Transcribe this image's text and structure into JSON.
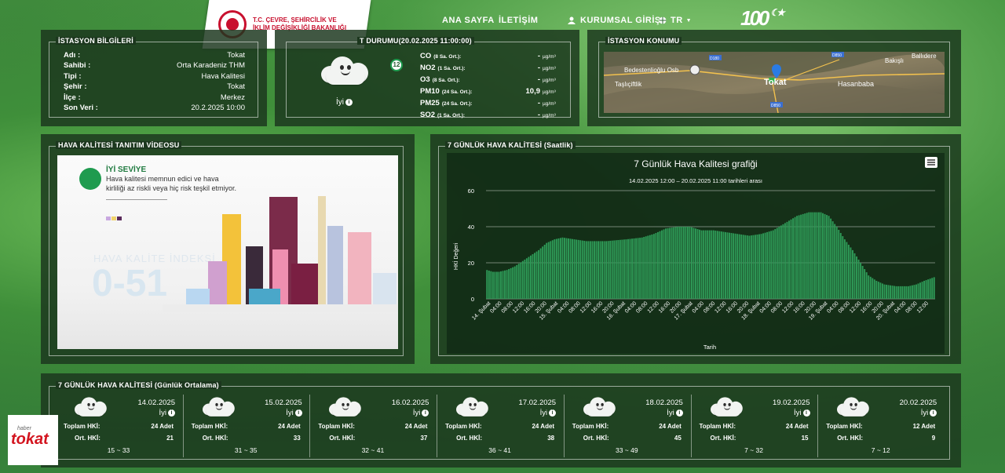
{
  "nav": {
    "home": "ANA SAYFA",
    "contact": "İLETİŞİM",
    "login": "KURUMSAL GİRİŞ",
    "lang": "TR",
    "anniversary": "100"
  },
  "logo": {
    "line1": "T.C. ÇEVRE, ŞEHİRCİLİK VE",
    "line2": "İKLİM DEĞİŞİKLİĞİ BAKANLIĞI"
  },
  "station": {
    "title": "İSTASYON BİLGİLERİ",
    "rows": [
      {
        "k": "Adı :",
        "v": "Tokat"
      },
      {
        "k": "Sahibi :",
        "v": "Orta Karadeniz THM"
      },
      {
        "k": "Tipi :",
        "v": "Hava Kalitesi"
      },
      {
        "k": "Şehir :",
        "v": "Tokat"
      },
      {
        "k": "İlçe :",
        "v": "Merkez"
      },
      {
        "k": "Son Veri :",
        "v": "20.2.2025 10:00"
      }
    ]
  },
  "current": {
    "title": "T DURUMU(20.02.2025 11:00:00)",
    "index": "12",
    "status": "İyi",
    "pollutants": [
      {
        "name": "CO",
        "avg": "(8 Sa. Ort.):",
        "value": "-",
        "unit": "µg/m³"
      },
      {
        "name": "NO2",
        "avg": "(1 Sa. Ort.):",
        "value": "-",
        "unit": "µg/m³"
      },
      {
        "name": "O3",
        "avg": "(8 Sa. Ort.):",
        "value": "-",
        "unit": "µg/m³"
      },
      {
        "name": "PM10",
        "avg": "(24 Sa. Ort.):",
        "value": "10,9",
        "unit": "µg/m³"
      },
      {
        "name": "PM25",
        "avg": "(24 Sa. Ort.):",
        "value": "-",
        "unit": "µg/m³"
      },
      {
        "name": "SO2",
        "avg": "(1 Sa. Ort.):",
        "value": "-",
        "unit": "µg/m³"
      }
    ]
  },
  "location": {
    "title": "İSTASYON KONUMU",
    "places": [
      "Bedestenlioğlu Osb",
      "Taşlıçiftlik",
      "Tokat",
      "Hasanbaba",
      "Bakışlı",
      "Ballıdere"
    ],
    "roads": [
      "D180",
      "D850",
      "D850"
    ]
  },
  "video": {
    "title": "HAVA KALİTESİ TANITIM VİDEOSU",
    "level_title": "İYİ SEVİYE",
    "level_text": "Hava kalitesi memnun edici ve hava kirliliği az riskli veya hiç risk teşkil etmiyor.",
    "index_label": "HAVA KALİTE İNDEKSİ",
    "index_range": "0-51"
  },
  "chart_panel": {
    "title": "7 GÜNLÜK HAVA KALİTESİ (Saatlik)"
  },
  "chart_data": {
    "type": "bar",
    "title": "7 Günlük Hava Kalitesi grafiği",
    "subtitle": "14.02.2025 12:00 – 20.02.2025 11:00 tarihleri arası",
    "xlabel": "Tarih",
    "ylabel": "HKİ Değeri",
    "ylim": [
      0,
      60
    ],
    "yticks": [
      0,
      20,
      40,
      60
    ],
    "tick_labels": [
      "14. Şubat",
      "04:00",
      "08:00",
      "12:00",
      "16:00",
      "20:00",
      "15. Şubat",
      "04:00",
      "08:00",
      "12:00",
      "16:00",
      "20:00",
      "16. Şubat",
      "04:00",
      "08:00",
      "12:00",
      "16:00",
      "20:00",
      "17. Şubat",
      "04:00",
      "08:00",
      "12:00",
      "16:00",
      "20:00",
      "18. Şubat",
      "04:00",
      "08:00",
      "12:00",
      "16:00",
      "20:00",
      "19. Şubat",
      "04:00",
      "08:00",
      "12:00",
      "16:00",
      "20:00",
      "20. Şubat",
      "04:00",
      "08:00",
      "12:00"
    ],
    "keypoints": [
      [
        0,
        16
      ],
      [
        3,
        15
      ],
      [
        6,
        15
      ],
      [
        10,
        16
      ],
      [
        14,
        18
      ],
      [
        18,
        21
      ],
      [
        22,
        24
      ],
      [
        26,
        27
      ],
      [
        30,
        31
      ],
      [
        34,
        33
      ],
      [
        38,
        34
      ],
      [
        44,
        33
      ],
      [
        50,
        32
      ],
      [
        60,
        32
      ],
      [
        70,
        33
      ],
      [
        78,
        34
      ],
      [
        84,
        36
      ],
      [
        90,
        39
      ],
      [
        96,
        40
      ],
      [
        102,
        40
      ],
      [
        108,
        38
      ],
      [
        114,
        38
      ],
      [
        120,
        37
      ],
      [
        126,
        36
      ],
      [
        132,
        35
      ],
      [
        138,
        36
      ],
      [
        144,
        38
      ],
      [
        150,
        42
      ],
      [
        156,
        46
      ],
      [
        162,
        48
      ],
      [
        168,
        48
      ],
      [
        172,
        46
      ],
      [
        176,
        40
      ],
      [
        180,
        33
      ],
      [
        184,
        27
      ],
      [
        188,
        20
      ],
      [
        192,
        13
      ],
      [
        196,
        10
      ],
      [
        200,
        8
      ],
      [
        206,
        7
      ],
      [
        212,
        7
      ],
      [
        216,
        8
      ],
      [
        220,
        10
      ],
      [
        225,
        12
      ]
    ]
  },
  "daily": {
    "title": "7 GÜNLÜK HAVA KALİTESİ (Günlük Ortalama)",
    "total_label": "Toplam HKİ:",
    "avg_label": "Ort. HKİ:",
    "days": [
      {
        "date": "14.02.2025",
        "status": "İyi",
        "total": "24 Adet",
        "avg": "21",
        "range": "15 ~ 33"
      },
      {
        "date": "15.02.2025",
        "status": "İyi",
        "total": "24 Adet",
        "avg": "33",
        "range": "31 ~ 35"
      },
      {
        "date": "16.02.2025",
        "status": "İyi",
        "total": "24 Adet",
        "avg": "37",
        "range": "32 ~ 41"
      },
      {
        "date": "17.02.2025",
        "status": "İyi",
        "total": "24 Adet",
        "avg": "38",
        "range": "36 ~ 41"
      },
      {
        "date": "18.02.2025",
        "status": "İyi",
        "total": "24 Adet",
        "avg": "45",
        "range": "33 ~ 49"
      },
      {
        "date": "19.02.2025",
        "status": "İyi",
        "total": "24 Adet",
        "avg": "15",
        "range": "7 ~ 32"
      },
      {
        "date": "20.02.2025",
        "status": "İyi",
        "total": "12 Adet",
        "avg": "9",
        "range": "7 ~ 12"
      }
    ]
  },
  "badge": {
    "small": "haber",
    "big": "tokat"
  },
  "colors": {
    "bar": "#2e9a57",
    "panel": "#1c371e",
    "accent_red": "#c8102e",
    "good": "#1f9b4f"
  }
}
